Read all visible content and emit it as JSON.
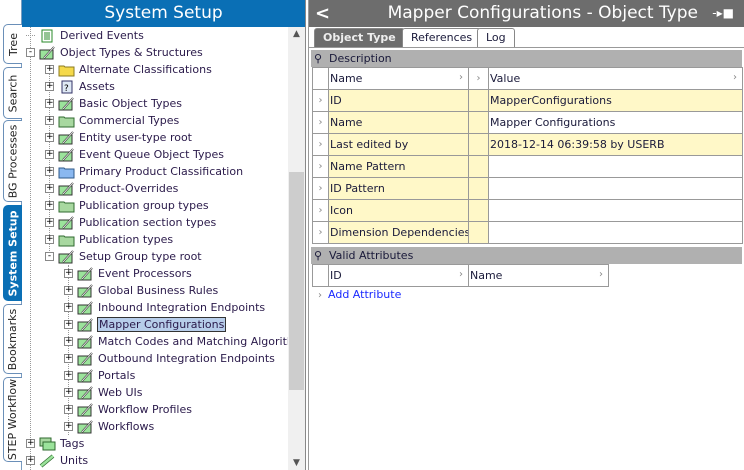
{
  "vertical_tabs": [
    {
      "label": "Tree",
      "active": false
    },
    {
      "label": "Search",
      "active": false
    },
    {
      "label": "BG Processes",
      "active": false
    },
    {
      "label": "System Setup",
      "active": true
    },
    {
      "label": "Bookmarks",
      "active": false
    },
    {
      "label": "STEP Workflow",
      "active": false
    }
  ],
  "left_panel": {
    "title": "System Setup"
  },
  "tree": [
    {
      "label": "Derived Events",
      "level": 0,
      "expander": "",
      "icon": "list-icon"
    },
    {
      "label": "Object Types & Structures",
      "level": 0,
      "expander": "-",
      "icon": "object-type-icon"
    },
    {
      "label": "Alternate Classifications",
      "level": 1,
      "expander": "+",
      "icon": "folder-yellow-icon"
    },
    {
      "label": "Assets",
      "level": 1,
      "expander": "+",
      "icon": "asset-icon"
    },
    {
      "label": "Basic Object Types",
      "level": 1,
      "expander": "+",
      "icon": "object-type-icon"
    },
    {
      "label": "Commercial Types",
      "level": 1,
      "expander": "+",
      "icon": "folder-green-icon"
    },
    {
      "label": "Entity user-type root",
      "level": 1,
      "expander": "+",
      "icon": "object-type-icon"
    },
    {
      "label": "Event Queue Object Types",
      "level": 1,
      "expander": "+",
      "icon": "object-type-icon"
    },
    {
      "label": "Primary Product Classification",
      "level": 1,
      "expander": "+",
      "icon": "folder-blue-icon"
    },
    {
      "label": "Product-Overrides",
      "level": 1,
      "expander": "+",
      "icon": "object-type-icon"
    },
    {
      "label": "Publication group types",
      "level": 1,
      "expander": "+",
      "icon": "folder-green-icon"
    },
    {
      "label": "Publication section types",
      "level": 1,
      "expander": "+",
      "icon": "object-type-icon"
    },
    {
      "label": "Publication types",
      "level": 1,
      "expander": "+",
      "icon": "folder-green-icon"
    },
    {
      "label": "Setup Group type root",
      "level": 1,
      "expander": "-",
      "icon": "object-type-icon"
    },
    {
      "label": "Event Processors",
      "level": 2,
      "expander": "+",
      "icon": "object-type-icon"
    },
    {
      "label": "Global Business Rules",
      "level": 2,
      "expander": "+",
      "icon": "object-type-icon"
    },
    {
      "label": "Inbound Integration Endpoints",
      "level": 2,
      "expander": "+",
      "icon": "object-type-icon"
    },
    {
      "label": "Mapper Configurations",
      "level": 2,
      "expander": "+",
      "icon": "object-type-icon",
      "selected": true
    },
    {
      "label": "Match Codes and Matching Algorithms",
      "level": 2,
      "expander": "+",
      "icon": "object-type-icon"
    },
    {
      "label": "Outbound Integration Endpoints",
      "level": 2,
      "expander": "+",
      "icon": "object-type-icon"
    },
    {
      "label": "Portals",
      "level": 2,
      "expander": "+",
      "icon": "object-type-icon"
    },
    {
      "label": "Web UIs",
      "level": 2,
      "expander": "+",
      "icon": "object-type-icon"
    },
    {
      "label": "Workflow Profiles",
      "level": 2,
      "expander": "+",
      "icon": "object-type-icon"
    },
    {
      "label": "Workflows",
      "level": 2,
      "expander": "+",
      "icon": "object-type-icon"
    },
    {
      "label": "Tags",
      "level": 0,
      "expander": "+",
      "icon": "tags-icon"
    },
    {
      "label": "Units",
      "level": 0,
      "expander": "+",
      "icon": "units-icon"
    }
  ],
  "right_panel": {
    "title": "Mapper Configurations - Object Type",
    "tabs": [
      {
        "label": "Object Type",
        "active": true
      },
      {
        "label": "References",
        "active": false
      },
      {
        "label": "Log",
        "active": false
      }
    ],
    "description": {
      "section": "Description",
      "col_name": "Name",
      "col_value": "Value",
      "rows": [
        {
          "name": "ID",
          "value": "MapperConfigurations",
          "value_yellow": true
        },
        {
          "name": "Name",
          "value": "Mapper Configurations",
          "value_yellow": false
        },
        {
          "name": "Last edited by",
          "value": "2018-12-14 06:39:58 by USERB",
          "value_yellow": true
        },
        {
          "name": "Name Pattern",
          "value": "",
          "value_yellow": false
        },
        {
          "name": "ID Pattern",
          "value": "",
          "value_yellow": false
        },
        {
          "name": "Icon",
          "value": "",
          "value_yellow": false
        },
        {
          "name": "Dimension Dependencies",
          "value": "",
          "value_yellow": false
        }
      ]
    },
    "valid_attributes": {
      "section": "Valid Attributes",
      "col_id": "ID",
      "col_name": "Name",
      "add_link": "Add Attribute"
    }
  }
}
